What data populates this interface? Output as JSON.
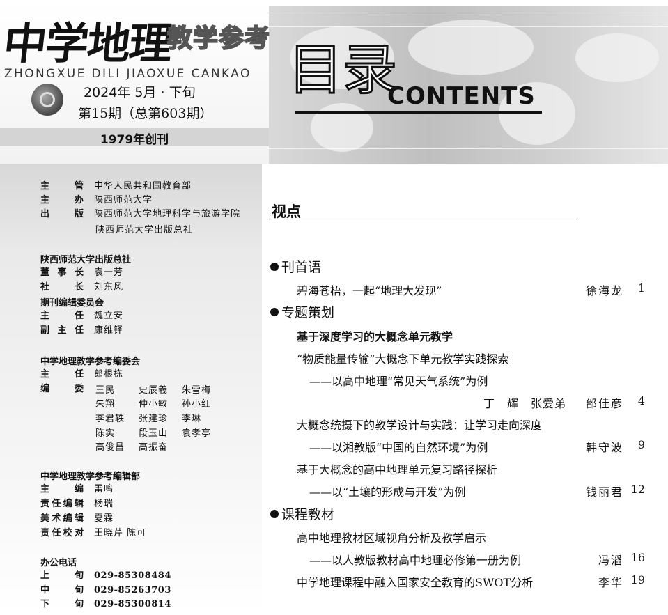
{
  "header": {
    "logo": "中学地理",
    "logo_sub": "教学参考",
    "pinyin": "ZHONGXUE DILI JIAOXUE CANKAO",
    "issue_date": "2024年 5月 · 下旬",
    "issue_no": "第15期（总第603期）",
    "founded": "1979年创刊",
    "toc_title_cn": "目录",
    "toc_title_en": "CONTENTS"
  },
  "masthead": {
    "top_rows": [
      {
        "label": "主管",
        "value": "中华人民共和国教育部"
      },
      {
        "label": "主办",
        "value": "陕西师范大学"
      },
      {
        "label": "出版",
        "value": "陕西师范大学地理科学与旅游学院"
      }
    ],
    "publisher2": "陕西师范大学出版总社",
    "press_head": "陕西师范大学出版总社",
    "press_rows": [
      {
        "label": "董事长",
        "value": "袁一芳"
      },
      {
        "label": "社长",
        "value": "刘东风"
      }
    ],
    "committee_head": "期刊编辑委员会",
    "committee_rows": [
      {
        "label": "主任",
        "value": "魏立安"
      },
      {
        "label": "副主任",
        "value": "康维铎"
      }
    ],
    "board_head": "中学地理教学参考编委会",
    "board_director": {
      "label": "主任",
      "value": "郎根栋"
    },
    "board_members_label": "编委",
    "board_members": [
      [
        "王民",
        "史辰羲",
        "朱雪梅"
      ],
      [
        "朱翔",
        "仲小敏",
        "孙小红"
      ],
      [
        "李君轶",
        "张建珍",
        "李琳"
      ],
      [
        "陈实",
        "段玉山",
        "袁孝亭"
      ],
      [
        "高俊昌",
        "高振奋"
      ]
    ],
    "office_head": "中学地理教学参考编辑部",
    "office_rows": [
      {
        "label": "主编",
        "value": "雷鸣"
      },
      {
        "label": "责任编辑",
        "value": "杨瑞"
      },
      {
        "label": "美术编辑",
        "value": "夏霖"
      },
      {
        "label": "责任校对",
        "value": "王晓芹 陈可"
      }
    ],
    "phone_head": "办公电话",
    "phones": [
      {
        "label": "上旬",
        "value": "029-85308484"
      },
      {
        "label": "中旬",
        "value": "029-85263703"
      },
      {
        "label": "下旬",
        "value": "029-85300814"
      }
    ]
  },
  "toc": {
    "section": "视点",
    "categories": [
      "刊首语",
      "专题策划",
      "课程教材"
    ],
    "entries": [
      {
        "title": "碧海苍梧，一起“地理大发现”",
        "author": "徐海龙",
        "page": "1"
      },
      {
        "title": "基于深度学习的大概念单元教学"
      },
      {
        "title": "“物质能量传输”大概念下单元教学实践探索"
      },
      {
        "title": "——以高中地理“常见天气系统”为例"
      },
      {
        "title": "丁　辉　张爱弟",
        "author": "邰佳彦",
        "page": "4"
      },
      {
        "title": "大概念统摄下的教学设计与实践：让学习走向深度"
      },
      {
        "title": "——以湘教版“中国的自然环境”为例",
        "author": "韩守波",
        "page": "9"
      },
      {
        "title": "基于大概念的高中地理单元复习路径探析"
      },
      {
        "title": "——以“土壤的形成与开发”为例",
        "author": "钱丽君",
        "page": "12"
      },
      {
        "title": "高中地理教材区域视角分析及教学启示"
      },
      {
        "title": "——以人教版教材高中地理必修第一册为例",
        "author": "冯滔",
        "page": "16"
      },
      {
        "title": "中学地理课程中融入国家安全教育的SWOT分析",
        "author": "李华",
        "page": "19"
      }
    ]
  }
}
